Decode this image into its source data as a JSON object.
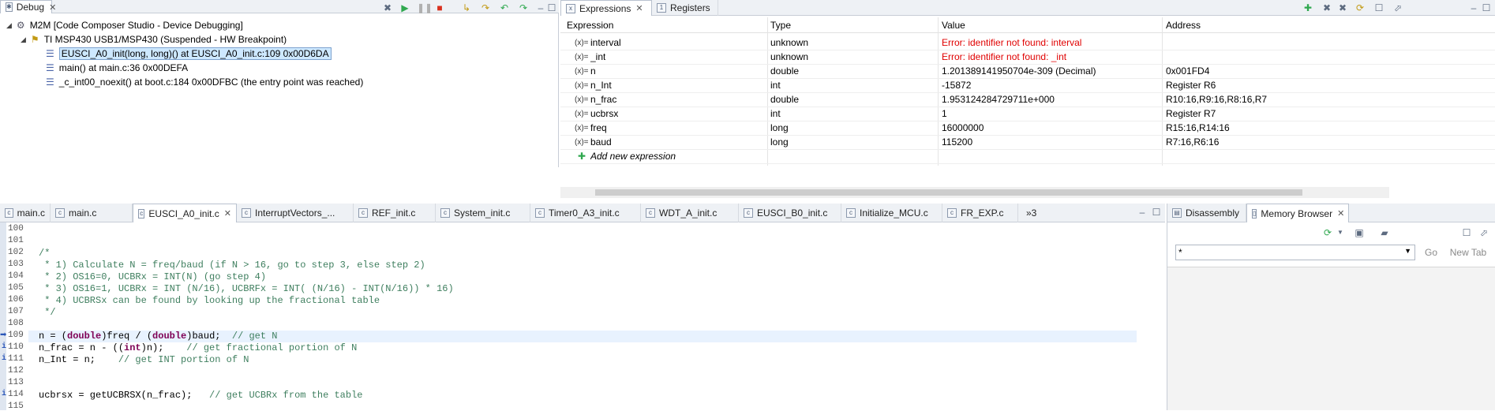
{
  "debug_view": {
    "tab_label": "Debug",
    "tree": [
      {
        "label": "M2M [Code Composer Studio - Device Debugging]"
      },
      {
        "label": "TI MSP430 USB1/MSP430 (Suspended - HW Breakpoint)"
      },
      {
        "label": "EUSCI_A0_init(long, long)() at EUSCI_A0_init.c:109 0x00D6DA"
      },
      {
        "label": "main() at main.c:36 0x00DEFA"
      },
      {
        "label": "_c_int00_noexit() at boot.c:184 0x00DFBC  (the entry point was reached)"
      }
    ]
  },
  "expressions_view": {
    "tab_label": "Expressions",
    "registers_tab_label": "Registers",
    "columns": [
      "Expression",
      "Type",
      "Value",
      "Address"
    ],
    "rows": [
      {
        "expr": "interval",
        "type": "unknown",
        "value": "Error: identifier not found: interval",
        "address": "",
        "error": true
      },
      {
        "expr": "_int",
        "type": "unknown",
        "value": "Error: identifier not found: _int",
        "address": "",
        "error": true
      },
      {
        "expr": "n",
        "type": "double",
        "value": "1.201389141950704e-309 (Decimal)",
        "address": "0x001FD4",
        "error": false
      },
      {
        "expr": "n_Int",
        "type": "int",
        "value": "-15872",
        "address": "Register R6",
        "error": false
      },
      {
        "expr": "n_frac",
        "type": "double",
        "value": "1.953124284729711e+000",
        "address": "R10:16,R9:16,R8:16,R7",
        "error": false
      },
      {
        "expr": "ucbrsx",
        "type": "int",
        "value": "1",
        "address": "Register R7",
        "error": false
      },
      {
        "expr": "freq",
        "type": "long",
        "value": "16000000",
        "address": "R15:16,R14:16",
        "error": false
      },
      {
        "expr": "baud",
        "type": "long",
        "value": "115200",
        "address": "R7:16,R6:16",
        "error": false
      }
    ],
    "add_new": "Add new expression",
    "icon_label": "(x)="
  },
  "editor": {
    "tabs": [
      {
        "label": "main.c"
      },
      {
        "label": "main.c"
      },
      {
        "label": "EUSCI_A0_init.c",
        "active": true
      },
      {
        "label": "InterruptVectors_..."
      },
      {
        "label": "REF_init.c"
      },
      {
        "label": "System_init.c"
      },
      {
        "label": "Timer0_A3_init.c"
      },
      {
        "label": "WDT_A_init.c"
      },
      {
        "label": "EUSCI_B0_init.c"
      },
      {
        "label": "Initialize_MCU.c"
      },
      {
        "label": "FR_EXP.c"
      }
    ],
    "overflow_label": "»3",
    "lines": [
      {
        "num": "100",
        "text": ""
      },
      {
        "num": "101",
        "text": ""
      },
      {
        "num": "102",
        "text": "/*",
        "style": "comment"
      },
      {
        "num": "103",
        "text": " * 1) Calculate N = freq/baud (if N > 16, go to step 3, else step 2)",
        "style": "comment"
      },
      {
        "num": "104",
        "text": " * 2) OS16=0, UCBRx = INT(N) (go step 4)",
        "style": "comment"
      },
      {
        "num": "105",
        "text": " * 3) OS16=1, UCBRx = INT (N/16), UCBRFx = INT( (N/16) - INT(N/16)) * 16)",
        "style": "comment"
      },
      {
        "num": "106",
        "text": " * 4) UCBRSx can be found by looking up the fractional table",
        "style": "comment"
      },
      {
        "num": "107",
        "text": " */",
        "style": "comment"
      },
      {
        "num": "108",
        "text": ""
      },
      {
        "num": "109",
        "text": "n = (double)freq / (double)baud;  // get N",
        "style": "current"
      },
      {
        "num": "110",
        "text": "n_frac = n - ((int)n);    // get fractional portion of N",
        "style": "code"
      },
      {
        "num": "111",
        "text": "n_Int = n;    // get INT portion of N",
        "style": "code"
      },
      {
        "num": "112",
        "text": ""
      },
      {
        "num": "113",
        "text": ""
      },
      {
        "num": "114",
        "text": "ucbrsx = getUCBRSX(n_frac);   // get UCBRx from the table",
        "style": "code"
      },
      {
        "num": "115",
        "text": ""
      }
    ]
  },
  "memory_view": {
    "disassembly_tab": "Disassembly",
    "memory_tab": "Memory Browser",
    "go_label": "Go",
    "new_tab_label": "New Tab",
    "address_prefix": "*"
  },
  "colors": {
    "error": "#e00000",
    "comment": "#3f7f5f",
    "keyword": "#7f0055",
    "current_line": "#e8f2fe",
    "tab_bar": "#eef1f5"
  }
}
